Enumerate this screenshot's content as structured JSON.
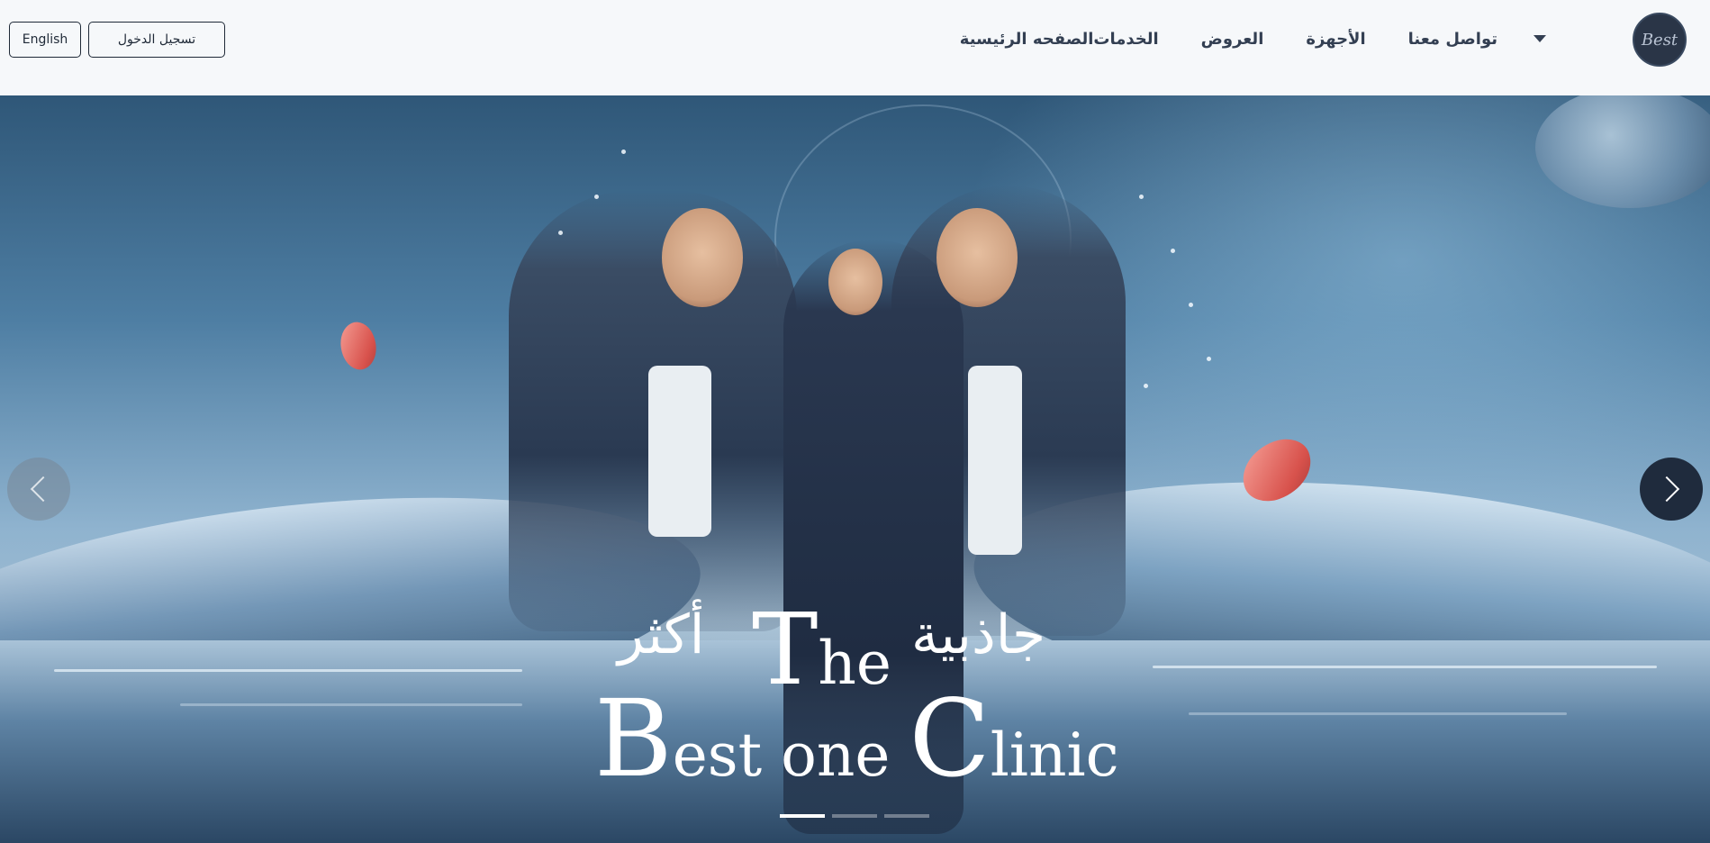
{
  "logo": {
    "text": "Best",
    "icon": "clinic-logo-icon"
  },
  "nav": {
    "items": [
      {
        "label": "الصفحه الرئيسية"
      },
      {
        "label": "الخدمات"
      },
      {
        "label": "العروض"
      },
      {
        "label": "الأجهزة"
      },
      {
        "label": "تواصل معنا"
      }
    ],
    "dropdown_icon": "caret-down-icon"
  },
  "header": {
    "login_label": "تسجيل الدخول",
    "language_label": "English"
  },
  "hero": {
    "slogan_right": "جاذبية",
    "slogan_left": "أكثر",
    "title_the_cap": "T",
    "title_the_rest": "he",
    "title_b_cap": "B",
    "title_b_rest": "est one ",
    "title_c_cap": "C",
    "title_c_rest": "linic",
    "prev_icon": "chevron-left-icon",
    "next_icon": "chevron-right-icon",
    "slide_count": 3,
    "active_slide": 1
  },
  "colors": {
    "nav_text": "#333f52",
    "navbar_bg": "#f6f8fa",
    "logo_bg": "#2a3547",
    "accent_dark": "#1f2b3d"
  }
}
